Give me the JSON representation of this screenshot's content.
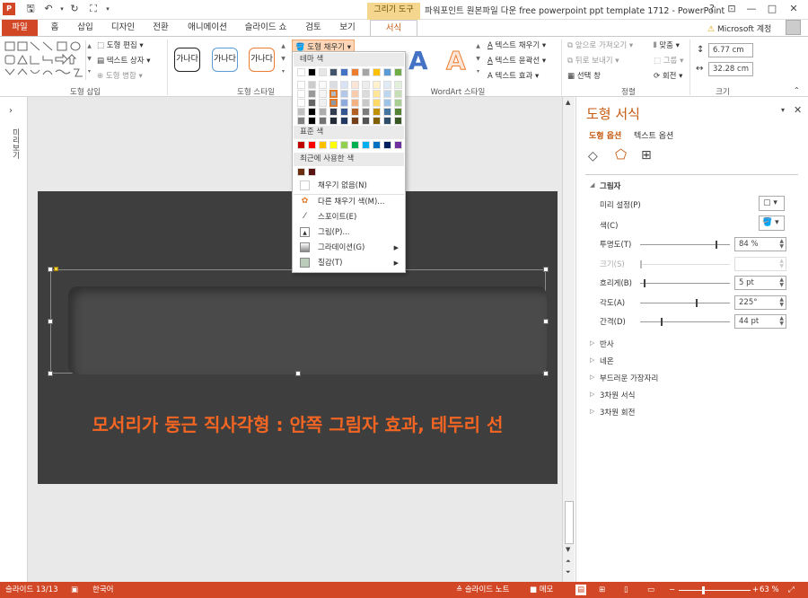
{
  "titlebar": {
    "context_header": "그리기 도구",
    "doc_title": "파워포인트 원본파일 다운 free powerpoint ppt template 1712 - PowerPoint",
    "help": "?",
    "restore_icon": "restore-icon",
    "minimize": "—",
    "maximize": "□",
    "close": "✕"
  },
  "tabs": [
    "파일",
    "홈",
    "삽입",
    "디자인",
    "전환",
    "애니메이션",
    "슬라이드 쇼",
    "검토",
    "보기",
    "서식"
  ],
  "account": "Microsoft 계정",
  "ribbon": {
    "insert_shapes": {
      "edit_shape": "도형 편집",
      "textbox": "텍스트 상자",
      "merge": "도형 병합",
      "label": "도형 삽입"
    },
    "shape_styles": {
      "sample": "가나다",
      "fill": "도형 채우기",
      "label": "도형 스타일"
    },
    "wordart": {
      "letter": "A",
      "text_fill": "텍스트 채우기",
      "text_outline": "텍스트 윤곽선",
      "text_effects": "텍스트 효과",
      "label": "WordArt 스타일"
    },
    "arrange": {
      "bring_forward": "앞으로 가져오기",
      "send_backward": "뒤로 보내기",
      "selection_pane": "선택 창",
      "align": "맞춤",
      "group": "그룹",
      "rotate": "회전",
      "label": "정렬"
    },
    "size": {
      "height": "6.77 cm",
      "width": "32.28 cm",
      "label": "크기"
    }
  },
  "leftpane": {
    "label": "미리보기"
  },
  "slide": {
    "caption": "모서리가 둥근 직사각형 : 안쪽 그림자 효과, 테두리 선"
  },
  "dropdown": {
    "theme_colors": "테마 색",
    "standard_colors": "표준 색",
    "recent_colors": "최근에 사용한 색",
    "no_fill": "채우기 없음(N)",
    "more_colors": "다른 채우기 색(M)...",
    "eyedropper": "스포이트(E)",
    "picture": "그림(P)...",
    "gradient": "그라데이션(G)",
    "texture": "질감(T)",
    "theme_top": [
      "#ffffff",
      "#000000",
      "#e7e6e6",
      "#44546a",
      "#4472c4",
      "#ed7d31",
      "#a5a5a5",
      "#ffc000",
      "#5b9bd5",
      "#70ad47"
    ],
    "standard": [
      "#c00000",
      "#ff0000",
      "#ffc000",
      "#ffff00",
      "#92d050",
      "#00b050",
      "#00b0f0",
      "#0070c0",
      "#002060",
      "#7030a0"
    ],
    "recent": [
      "#6b2e0e",
      "#5a1414"
    ]
  },
  "format_pane": {
    "title": "도형 서식",
    "tab_shape": "도형 옵션",
    "tab_text": "텍스트 옵션",
    "shadow_section": "그림자",
    "presets": "미리 설정(P)",
    "color": "색(C)",
    "transparency": "투명도(T)",
    "transparency_val": "84 %",
    "transparency_frac": 0.84,
    "size": "크기(S)",
    "blur": "흐리게(B)",
    "blur_val": "5 pt",
    "angle": "각도(A)",
    "angle_val": "225°",
    "distance": "간격(D)",
    "distance_val": "44 pt",
    "sections": [
      "반사",
      "네온",
      "부드러운 가장자리",
      "3차원 서식",
      "3차원 회전"
    ]
  },
  "status": {
    "slide": "슬라이드 13/13",
    "lang": "한국어",
    "notes": "슬라이드 노트",
    "comments": "메모",
    "zoom": "63 %",
    "minus": "−",
    "plus": "+"
  },
  "colors": {
    "accent": "#d24726",
    "context": "#f4d68f",
    "tab_format": "#c55a11",
    "slide_bg": "#3e3e3e",
    "caption": "#f26522"
  }
}
